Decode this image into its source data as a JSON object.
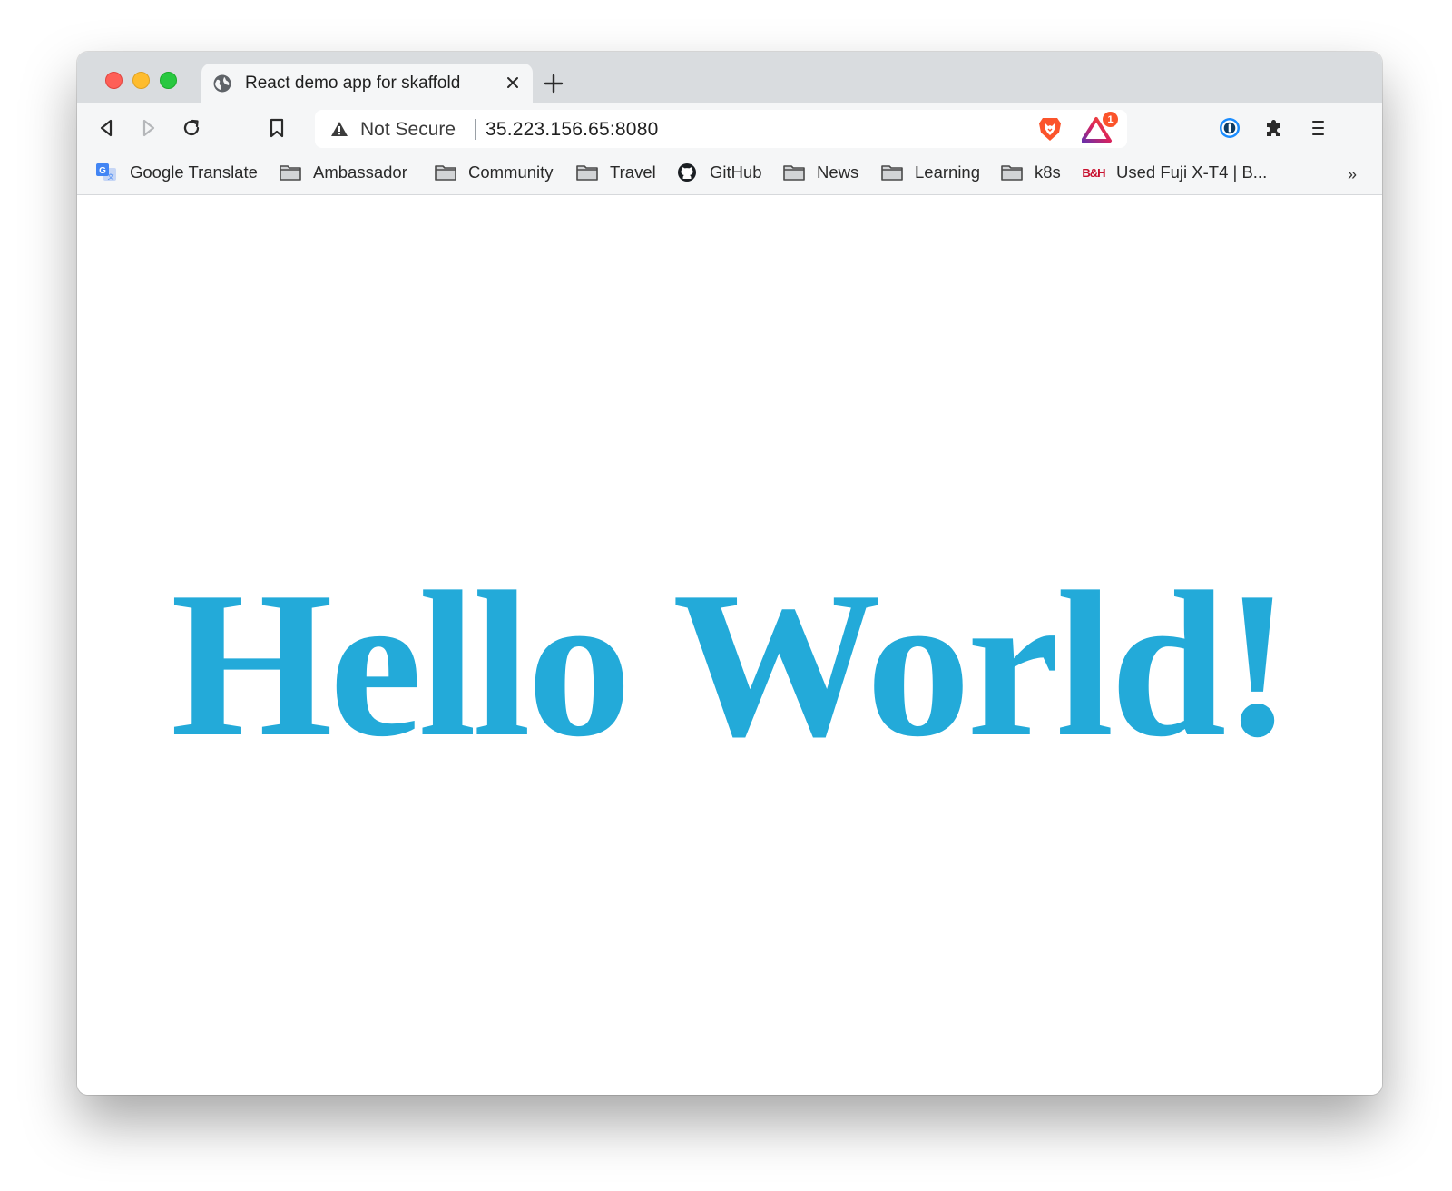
{
  "window": {
    "tab": {
      "title": "React demo app for skaffold"
    }
  },
  "toolbar": {
    "security_label": "Not Secure",
    "url": "35.223.156.65:8080",
    "rewards_badge": "1"
  },
  "bookmarks": {
    "items": [
      {
        "label": "Google Translate",
        "icon": "google-translate-icon"
      },
      {
        "label": "Ambassador",
        "icon": "folder-icon"
      },
      {
        "label": "Community",
        "icon": "folder-icon"
      },
      {
        "label": "Travel",
        "icon": "folder-icon"
      },
      {
        "label": "GitHub",
        "icon": "github-icon"
      },
      {
        "label": "News",
        "icon": "folder-icon"
      },
      {
        "label": "Learning",
        "icon": "folder-icon"
      },
      {
        "label": "k8s",
        "icon": "folder-icon"
      },
      {
        "label": "Used Fuji X-T4 | B...",
        "icon": "bh-icon"
      }
    ],
    "overflow": "»"
  },
  "page": {
    "heading": "Hello World!",
    "heading_color": "#23aad9"
  }
}
